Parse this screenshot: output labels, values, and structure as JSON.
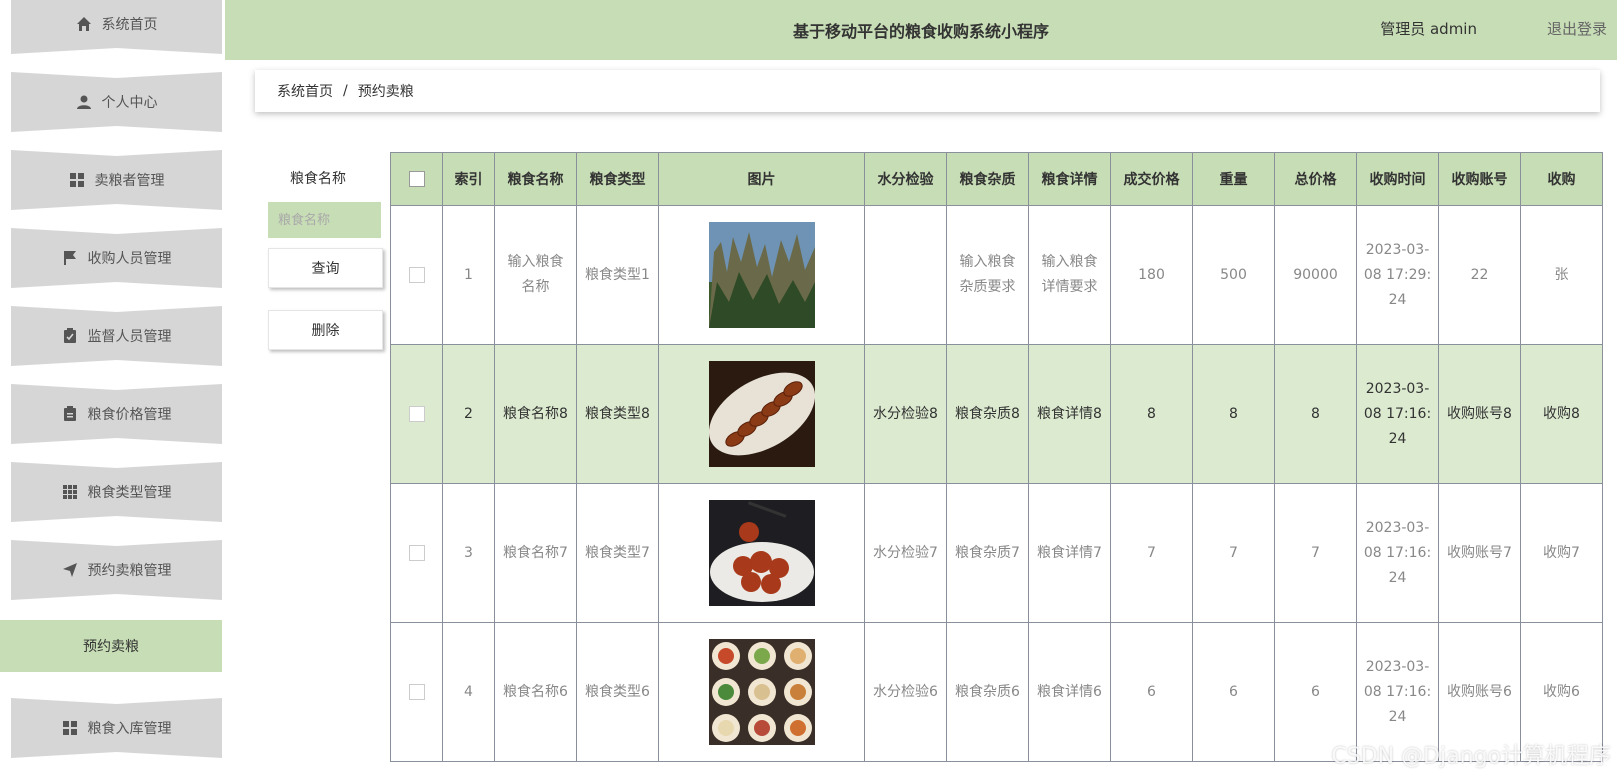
{
  "app": {
    "title": "基于移动平台的粮食收购系统小程序",
    "user": "管理员 admin",
    "logout": "退出登录"
  },
  "sidebar": {
    "items": [
      {
        "label": "系统首页",
        "icon": "home-icon"
      },
      {
        "label": "个人中心",
        "icon": "user-icon"
      },
      {
        "label": "卖粮者管理",
        "icon": "grid-icon"
      },
      {
        "label": "收购人员管理",
        "icon": "flag-icon"
      },
      {
        "label": "监督人员管理",
        "icon": "clipboard-check-icon"
      },
      {
        "label": "粮食价格管理",
        "icon": "clipboard-icon"
      },
      {
        "label": "粮食类型管理",
        "icon": "apps-icon"
      },
      {
        "label": "预约卖粮管理",
        "icon": "send-icon"
      },
      {
        "label": "预约卖粮",
        "icon": ""
      },
      {
        "label": "粮食入库管理",
        "icon": "grid-icon"
      }
    ]
  },
  "breadcrumb": {
    "home": "系统首页",
    "separator": "/",
    "current": "预约卖粮"
  },
  "search": {
    "label": "粮食名称",
    "placeholder": "粮食名称",
    "query_button": "查询",
    "delete_button": "删除"
  },
  "table": {
    "headers": [
      "索引",
      "粮食名称",
      "粮食类型",
      "图片",
      "水分检验",
      "粮食杂质",
      "粮食详情",
      "成交价格",
      "重量",
      "总价格",
      "收购时间",
      "收购账号",
      "收购"
    ],
    "rows": [
      {
        "index": "1",
        "name": "输入粮食名称",
        "type": "粮食类型1",
        "image": "mountain-photo",
        "moisture": "",
        "impurity": "输入粮食杂质要求",
        "detail": "输入粮食详情要求",
        "price": "180",
        "weight": "500",
        "total": "90000",
        "time": "2023-03-08 17:29:24",
        "account": "22",
        "buyer": "张"
      },
      {
        "index": "2",
        "name": "粮食名称8",
        "type": "粮食类型8",
        "image": "braised-pork-photo",
        "moisture": "水分检验8",
        "impurity": "粮食杂质8",
        "detail": "粮食详情8",
        "price": "8",
        "weight": "8",
        "total": "8",
        "time": "2023-03-08 17:16:24",
        "account": "收购账号8",
        "buyer": "收购8"
      },
      {
        "index": "3",
        "name": "粮食名称7",
        "type": "粮食类型7",
        "image": "sweet-sour-pork-photo",
        "moisture": "水分检验7",
        "impurity": "粮食杂质7",
        "detail": "粮食详情7",
        "price": "7",
        "weight": "7",
        "total": "7",
        "time": "2023-03-08 17:16:24",
        "account": "收购账号7",
        "buyer": "收购7"
      },
      {
        "index": "4",
        "name": "粮食名称6",
        "type": "粮食类型6",
        "image": "dishes-grid-photo",
        "moisture": "水分检验6",
        "impurity": "粮食杂质6",
        "detail": "粮食详情6",
        "price": "6",
        "weight": "6",
        "total": "6",
        "time": "2023-03-08 17:16:24",
        "account": "收购账号6",
        "buyer": "收购6"
      }
    ]
  },
  "watermark": "CSDN @Django计算机程序",
  "colors": {
    "accent": "#c7ddb5",
    "highlight_row": "#dcebd0",
    "sidebar_item": "#d6d6d6"
  }
}
